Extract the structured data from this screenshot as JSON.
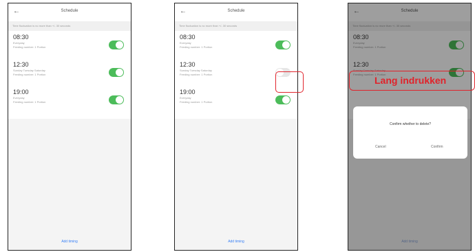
{
  "screens": [
    {
      "header": {
        "back_icon": "arrow-left-icon",
        "title": "Schedule"
      },
      "note": "Time fluctuation is no more than +/- 30 seconds",
      "items": [
        {
          "time": "08:30",
          "repeat": "Everyday",
          "action": "Feeding number: 1 Portion",
          "toggle_on": true
        },
        {
          "time": "12:30",
          "repeat": "Sunday Tuesday Saturday",
          "action": "Feeding number: 1 Portion",
          "toggle_on": true
        },
        {
          "time": "19:00",
          "repeat": "Everyday",
          "action": "Feeding number: 1 Portion",
          "toggle_on": true
        }
      ],
      "add_label": "Add timing"
    },
    {
      "header": {
        "back_icon": "arrow-left-icon",
        "title": "Schedule"
      },
      "note": "Time fluctuation is no more than +/- 30 seconds",
      "items": [
        {
          "time": "08:30",
          "repeat": "Everyday",
          "action": "Feeding number: 1 Portion",
          "toggle_on": true
        },
        {
          "time": "12:30",
          "repeat": "Sunday Tuesday Saturday",
          "action": "Feeding number: 1 Portion",
          "toggle_on": false
        },
        {
          "time": "19:00",
          "repeat": "Everyday",
          "action": "Feeding number: 1 Portion",
          "toggle_on": true
        }
      ],
      "add_label": "Add timing"
    },
    {
      "header": {
        "back_icon": "arrow-left-icon",
        "title": "Schedule"
      },
      "note": "Time fluctuation is no more than +/- 30 seconds",
      "items": [
        {
          "time": "08:30",
          "repeat": "Everyday",
          "action": "Feeding number: 1 Portion",
          "toggle_on": true
        },
        {
          "time": "12:30",
          "repeat": "Sunday Tuesday Saturday",
          "action": "Feeding number: 1 Portion",
          "toggle_on": true
        },
        {
          "time": "",
          "repeat": "",
          "action": "",
          "toggle_on": false
        }
      ],
      "add_label": "Add timing"
    }
  ],
  "annotation_label": "Lang indrukken",
  "dialog": {
    "title": "Confirm whether to delete?",
    "cancel": "Cancel",
    "confirm": "Confirm"
  },
  "colors": {
    "toggle_on": "#4cbc5a",
    "toggle_off": "#e6e6e6",
    "link": "#3b82f6",
    "highlight": "#e0232b"
  }
}
